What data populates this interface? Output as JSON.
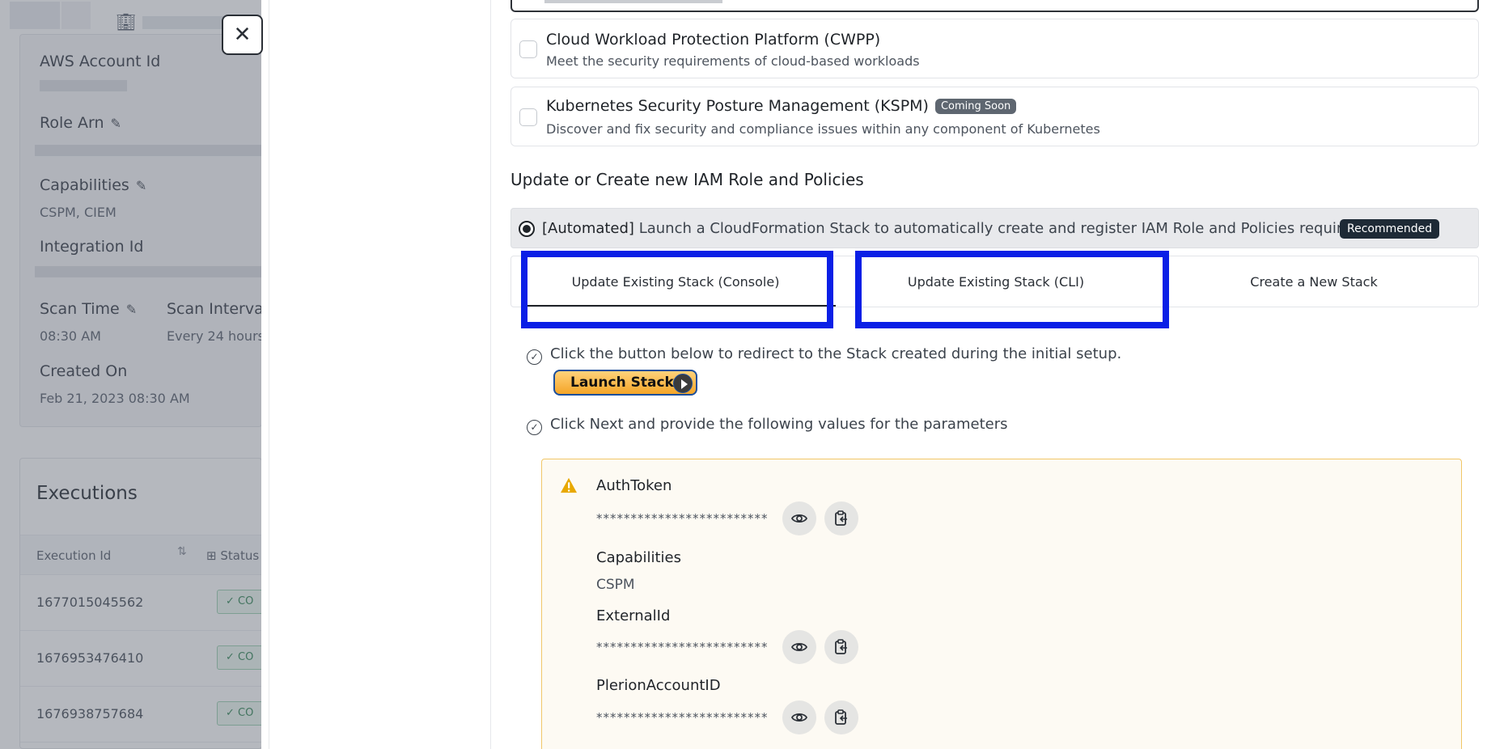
{
  "background": {
    "fields": {
      "aws_account_id_label": "AWS Account Id",
      "role_arn_label": "Role Arn",
      "capabilities_label": "Capabilities",
      "capabilities_value": "CSPM, CIEM",
      "integration_id_label": "Integration Id",
      "scan_time_label": "Scan Time",
      "scan_time_value": "08:30 AM",
      "scan_interval_label": "Scan Interval",
      "scan_interval_value": "Every 24 hours",
      "created_on_label": "Created On",
      "created_on_value": "Feb 21, 2023 08:30 AM"
    },
    "executions": {
      "title": "Executions",
      "col_execution_id": "Execution Id",
      "col_status": "Status",
      "rows": [
        {
          "id": "1677015045562",
          "status": "CO"
        },
        {
          "id": "1676953476410",
          "status": "CO"
        },
        {
          "id": "1676938757684",
          "status": "CO"
        }
      ]
    }
  },
  "close_icon_glyph": "✕",
  "options": [
    {
      "title": "Cloud Workload Protection Platform (CWPP)",
      "description": "Meet the security requirements of cloud-based workloads",
      "badge": ""
    },
    {
      "title": "Kubernetes Security Posture Management (KSPM)",
      "description": "Discover and fix security and compliance issues within any component of Kubernetes",
      "badge": "Coming Soon"
    }
  ],
  "section_title": "Update or Create new IAM Role and Policies",
  "automated": {
    "tag": "[Automated]",
    "text": " Launch a CloudFormation Stack to automatically create and register IAM Role and Policies required.",
    "badge": "Recommended"
  },
  "tabs": [
    {
      "label": "Update Existing Stack (Console)",
      "active": true
    },
    {
      "label": "Update Existing Stack (CLI)",
      "active": false
    },
    {
      "label": "Create a New Stack",
      "active": false
    }
  ],
  "steps": [
    "Click the button below to redirect to the Stack created during the initial setup.",
    "Click Next and provide the following values for the parameters"
  ],
  "launch_button": "Launch Stack",
  "parameters": [
    {
      "name": "AuthToken",
      "value": "*************************"
    },
    {
      "name": "Capabilities",
      "value": "CSPM"
    },
    {
      "name": "ExternalId",
      "value": "*************************"
    },
    {
      "name": "PlerionAccountID",
      "value": "*************************"
    }
  ],
  "colors": {
    "highlight": "#0a1fe6",
    "recommended_badge": "#1e2a36",
    "coming_soon_badge": "#5e6670",
    "warning": "#e8a800",
    "launch_button": "#f4a528"
  },
  "icons": {
    "close": "close-icon",
    "pencil": "pencil-icon",
    "building": "building-icon",
    "warning": "warning-icon",
    "eye": "eye-icon",
    "copy": "copy-icon",
    "check_circle": "check-circle-icon",
    "play": "play-icon"
  }
}
